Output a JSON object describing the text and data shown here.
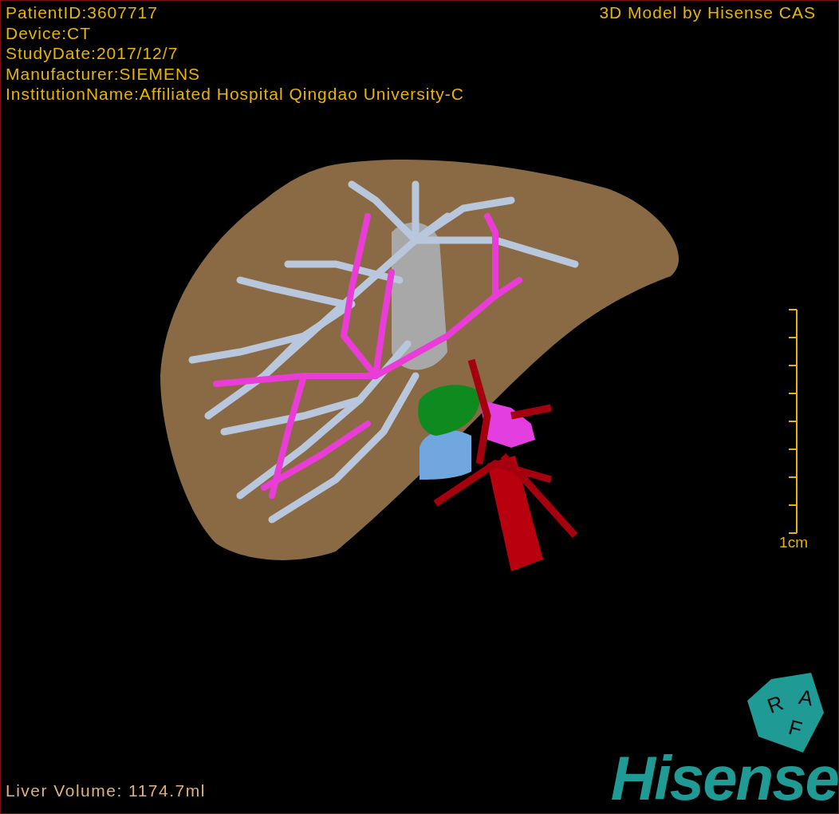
{
  "info_lines": [
    "PatientID:3607717",
    "Device:CT",
    "StudyDate:2017/12/7",
    "Manufacturer:SIEMENS",
    "InstitutionName:Affiliated Hospital Qingdao University-C"
  ],
  "title": "3D Model by Hisense CAS",
  "scale_bar": {
    "label": "1cm"
  },
  "orientation_cube": {
    "faces": [
      "R",
      "A",
      "F"
    ]
  },
  "volume": "Liver Volume: 1174.7ml",
  "logo": "Hisense"
}
